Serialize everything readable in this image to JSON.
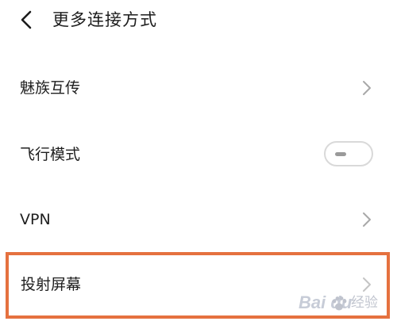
{
  "header": {
    "title": "更多连接方式"
  },
  "items": [
    {
      "label": "魅族互传"
    },
    {
      "label": "飞行模式"
    },
    {
      "label": "VPN"
    },
    {
      "label": "投射屏幕"
    }
  ],
  "airplane_mode": {
    "enabled": false
  },
  "watermark": {
    "brand": "Bai",
    "brand_suffix": "du",
    "sub": "经验"
  },
  "colors": {
    "highlight": "#e5713f",
    "text": "#1f1f1f",
    "chevron": "#a8a8a8"
  },
  "icons": {
    "back": "back-arrow-icon",
    "chevron": "chevron-right-icon",
    "watermark": "baidu-paw-icon"
  }
}
